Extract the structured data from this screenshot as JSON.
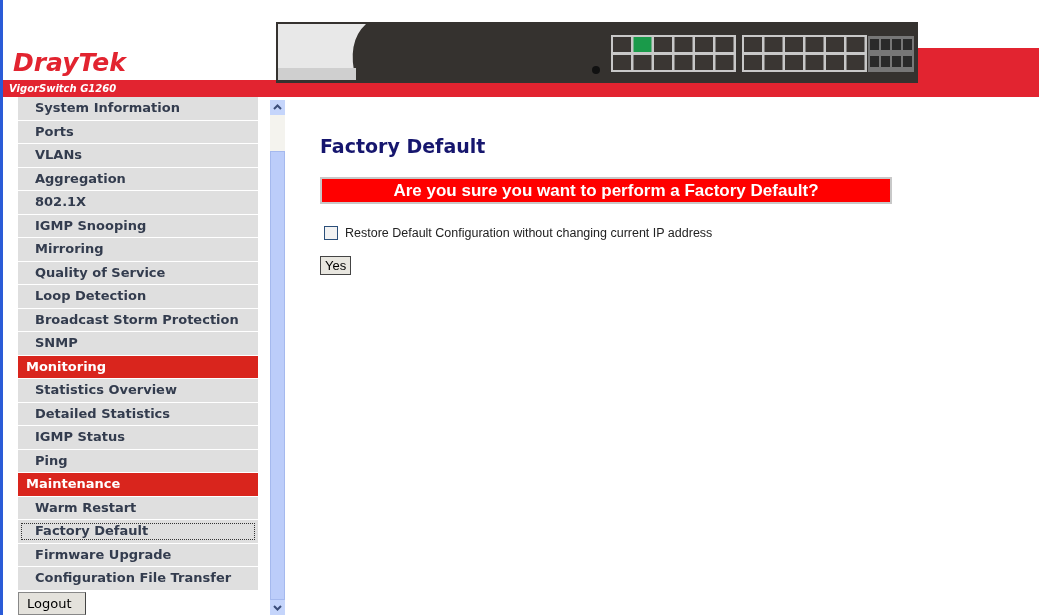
{
  "header": {
    "logo": "DrayTek",
    "model": "VigorSwitch G1260"
  },
  "sidebar": {
    "items": [
      {
        "label": "System Information",
        "kind": "item",
        "selected": false
      },
      {
        "label": "Ports",
        "kind": "item",
        "selected": false
      },
      {
        "label": "VLANs",
        "kind": "item",
        "selected": false
      },
      {
        "label": "Aggregation",
        "kind": "item",
        "selected": false
      },
      {
        "label": "802.1X",
        "kind": "item",
        "selected": false
      },
      {
        "label": "IGMP Snooping",
        "kind": "item",
        "selected": false
      },
      {
        "label": "Mirroring",
        "kind": "item",
        "selected": false
      },
      {
        "label": "Quality of Service",
        "kind": "item",
        "selected": false
      },
      {
        "label": "Loop Detection",
        "kind": "item",
        "selected": false
      },
      {
        "label": "Broadcast Storm Protection",
        "kind": "item",
        "selected": false
      },
      {
        "label": "SNMP",
        "kind": "item",
        "selected": false
      },
      {
        "label": "Monitoring",
        "kind": "header",
        "selected": false
      },
      {
        "label": "Statistics Overview",
        "kind": "item",
        "selected": false
      },
      {
        "label": "Detailed Statistics",
        "kind": "item",
        "selected": false
      },
      {
        "label": "IGMP Status",
        "kind": "item",
        "selected": false
      },
      {
        "label": "Ping",
        "kind": "item",
        "selected": false
      },
      {
        "label": "Maintenance",
        "kind": "header",
        "selected": false
      },
      {
        "label": "Warm Restart",
        "kind": "item",
        "selected": false
      },
      {
        "label": "Factory Default",
        "kind": "item",
        "selected": true
      },
      {
        "label": "Firmware Upgrade",
        "kind": "item",
        "selected": false
      },
      {
        "label": "Configuration File Transfer",
        "kind": "item",
        "selected": false
      }
    ],
    "logout": "Logout"
  },
  "content": {
    "title": "Factory Default",
    "warning": "Are you sure you want to perform a Factory Default?",
    "option": {
      "label": "Restore Default Configuration without changing current IP address",
      "checked": false
    },
    "button": "Yes"
  }
}
